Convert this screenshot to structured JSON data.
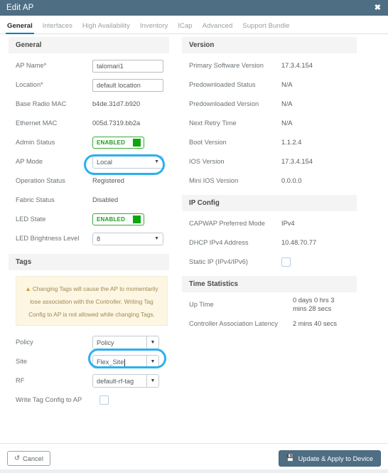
{
  "window": {
    "title": "Edit AP",
    "close_icon": "close-icon",
    "close_glyph": "✖"
  },
  "tabs": [
    {
      "label": "General",
      "active": true
    },
    {
      "label": "Interfaces",
      "active": false
    },
    {
      "label": "High Availability",
      "active": false
    },
    {
      "label": "Inventory",
      "active": false
    },
    {
      "label": "ICap",
      "active": false
    },
    {
      "label": "Advanced",
      "active": false
    },
    {
      "label": "Support Bundle",
      "active": false
    }
  ],
  "left": {
    "general": {
      "heading": "General",
      "ap_name": {
        "label": "AP Name*",
        "value": "talomari1"
      },
      "location": {
        "label": "Location*",
        "value": "default location"
      },
      "base_radio_mac": {
        "label": "Base Radio MAC",
        "value": "b4de.31d7.b920"
      },
      "ethernet_mac": {
        "label": "Ethernet MAC",
        "value": "005d.7319.bb2a"
      },
      "admin_status": {
        "label": "Admin Status",
        "value": "ENABLED"
      },
      "ap_mode": {
        "label": "AP Mode",
        "value": "Local"
      },
      "operation_status": {
        "label": "Operation Status",
        "value": "Registered"
      },
      "fabric_status": {
        "label": "Fabric Status",
        "value": "Disabled"
      },
      "led_state": {
        "label": "LED State",
        "value": "ENABLED"
      },
      "led_brightness": {
        "label": "LED Brightness Level",
        "value": "8"
      }
    },
    "tags": {
      "heading": "Tags",
      "warning": "Changing Tags will cause the AP to momentarily lose association with the Controller. Writing Tag Config to AP is not allowed while changing Tags.",
      "warning_icon": "warning-triangle-icon",
      "policy": {
        "label": "Policy",
        "value": "Policy"
      },
      "site": {
        "label": "Site",
        "value": "Flex_Site"
      },
      "rf": {
        "label": "RF",
        "value": "default-rf-tag"
      },
      "write_tag_config": {
        "label": "Write Tag Config to AP",
        "checked": false
      }
    }
  },
  "right": {
    "version": {
      "heading": "Version",
      "rows": [
        {
          "label": "Primary Software Version",
          "value": "17.3.4.154"
        },
        {
          "label": "Predownloaded Status",
          "value": "N/A"
        },
        {
          "label": "Predownloaded Version",
          "value": "N/A"
        },
        {
          "label": "Next Retry Time",
          "value": "N/A"
        },
        {
          "label": "Boot Version",
          "value": "1.1.2.4"
        },
        {
          "label": "IOS Version",
          "value": "17.3.4.154"
        },
        {
          "label": "Mini IOS Version",
          "value": "0.0.0.0"
        }
      ]
    },
    "ip_config": {
      "heading": "IP Config",
      "capwap_mode": {
        "label": "CAPWAP Preferred Mode",
        "value": "IPv4"
      },
      "dhcp_ipv4": {
        "label": "DHCP IPv4 Address",
        "value": "10.48.70.77"
      },
      "static_ip": {
        "label": "Static IP (IPv4/IPv6)",
        "checked": false
      }
    },
    "time_statistics": {
      "heading": "Time Statistics",
      "up_time": {
        "label": "Up Time",
        "value": "0 days 0 hrs 3 mins 28 secs"
      },
      "latency": {
        "label": "Controller Association Latency",
        "value": "2 mins 40 secs"
      }
    }
  },
  "footer": {
    "cancel": {
      "label": "Cancel",
      "icon": "undo-icon",
      "glyph": "↺"
    },
    "apply": {
      "label": "Update & Apply to Device",
      "icon": "save-disk-icon",
      "glyph": "Ὃe"
    }
  },
  "colors": {
    "header_bg": "#4e6e84",
    "accent_tab": "#0d7bc4",
    "highlight": "#2ab0ee",
    "enabled_green": "#0aa80a",
    "warning_bg": "#fdf6e3"
  }
}
